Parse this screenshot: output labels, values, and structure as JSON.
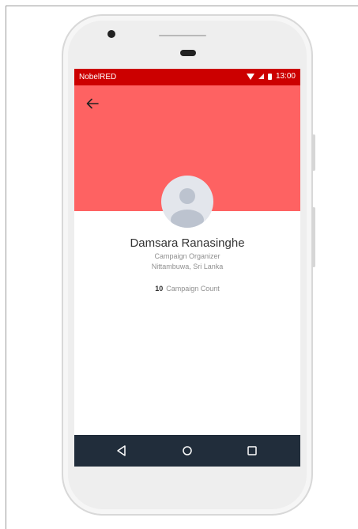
{
  "status_bar": {
    "carrier": "NobelRED",
    "time": "13:00",
    "icons": [
      "wifi-icon",
      "signal-icon",
      "battery-icon"
    ]
  },
  "header": {
    "back_icon": "back-arrow-icon",
    "background_color": "#fe6262"
  },
  "profile": {
    "name": "Damsara Ranasinghe",
    "role": "Campaign Organizer",
    "location": "Nittambuwa, Sri Lanka",
    "campaign_count": "10",
    "campaign_count_label": "Campaign Count"
  },
  "nav_bar": {
    "buttons": [
      "back-triangle-icon",
      "home-circle-icon",
      "recents-square-icon"
    ]
  },
  "colors": {
    "status_bar": "#cc0000",
    "header": "#fe6262",
    "nav_bar": "#212d3b"
  }
}
